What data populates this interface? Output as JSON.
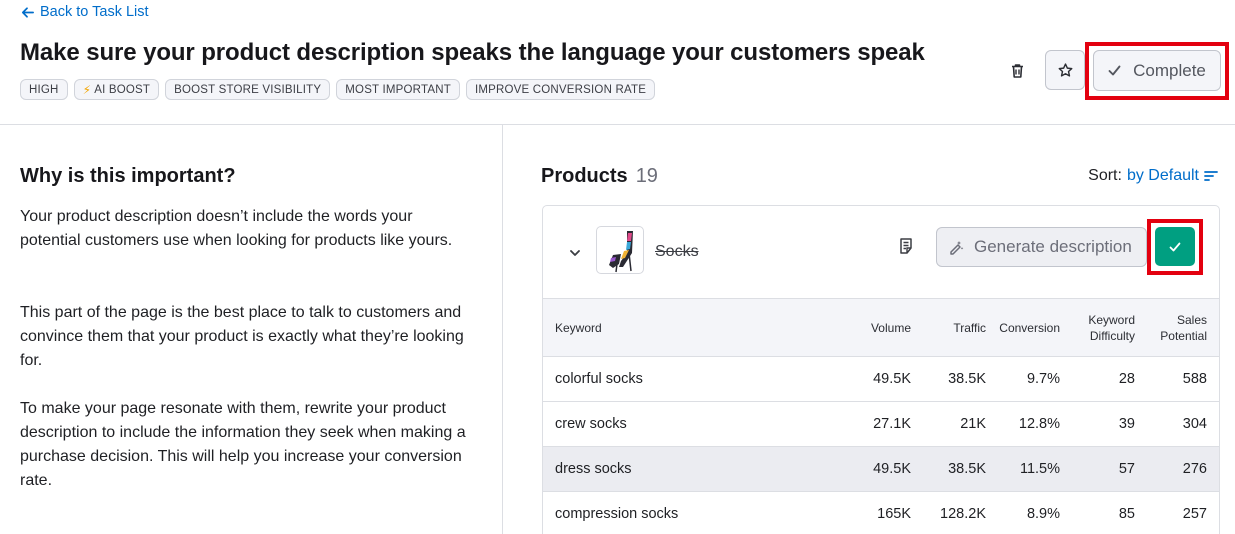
{
  "header": {
    "back_label": "Back to Task List",
    "title": "Make sure your product description speaks the language your customers speak",
    "tags": [
      "HIGH",
      "AI BOOST",
      "BOOST STORE VISIBILITY",
      "MOST IMPORTANT",
      "IMPROVE CONVERSION RATE"
    ],
    "complete_label": "Complete"
  },
  "why": {
    "title": "Why is this important?",
    "p1": "Your product description doesn’t include the words your potential customers use when looking for products like yours.",
    "p2": "This part of the page is the best place to talk to customers and convince them that your product is exactly what they’re looking for.",
    "p3": "To make your page resonate with them, rewrite your product description to include the information they seek when making a purchase decision. This will help you increase your conversion rate."
  },
  "products": {
    "title": "Products",
    "count": "19",
    "sort_label": "Sort:",
    "sort_value": "by Default"
  },
  "product": {
    "name": "Socks",
    "generate_label": "Generate description"
  },
  "table": {
    "headers": {
      "keyword": "Keyword",
      "volume": "Volume",
      "traffic": "Traffic",
      "conversion": "Conversion",
      "kd_line1": "Keyword",
      "kd_line2": "Difficulty",
      "sp_line1": "Sales",
      "sp_line2": "Potential"
    },
    "rows": [
      {
        "keyword": "colorful socks",
        "volume": "49.5K",
        "traffic": "38.5K",
        "conversion": "9.7%",
        "kd": "28",
        "sp": "588"
      },
      {
        "keyword": "crew socks",
        "volume": "27.1K",
        "traffic": "21K",
        "conversion": "12.8%",
        "kd": "39",
        "sp": "304"
      },
      {
        "keyword": "dress socks",
        "volume": "49.5K",
        "traffic": "38.5K",
        "conversion": "11.5%",
        "kd": "57",
        "sp": "276"
      },
      {
        "keyword": "compression socks",
        "volume": "165K",
        "traffic": "128.2K",
        "conversion": "8.9%",
        "kd": "85",
        "sp": "257"
      }
    ]
  },
  "colors": {
    "accent_link": "#006dca",
    "highlight_red": "#e3000f",
    "complete_green": "#009f81"
  },
  "icons": [
    "arrow-left-icon",
    "trash-icon",
    "star-icon",
    "check-icon",
    "bolt-icon",
    "sort-icon",
    "chevron-down-icon",
    "notes-icon",
    "magic-pen-icon"
  ]
}
